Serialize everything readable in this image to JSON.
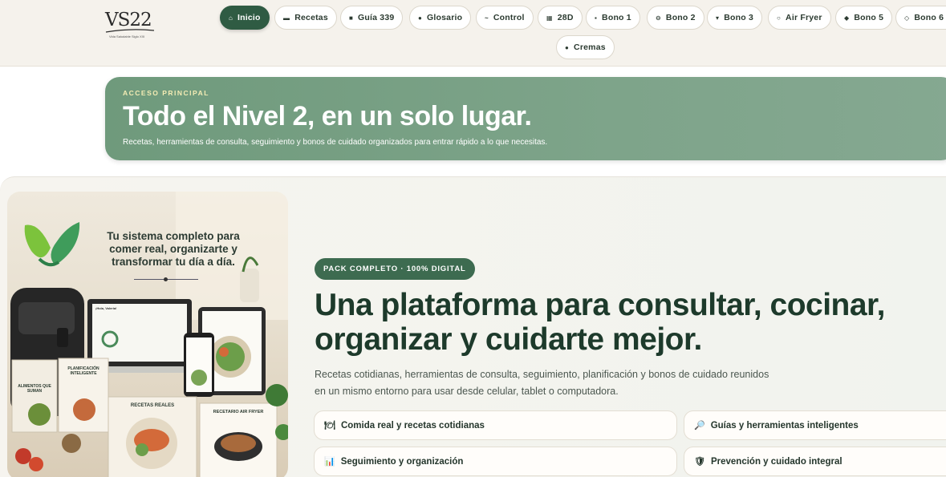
{
  "logo": {
    "text": "VS22",
    "subtitle": "Vida Saludable Siglo XXI"
  },
  "nav": [
    {
      "label": "Inicio",
      "icon": "home-icon",
      "glyph": "⌂"
    },
    {
      "label": "Recetas",
      "icon": "book-icon",
      "glyph": "▬"
    },
    {
      "label": "Guía 339",
      "icon": "guide-icon",
      "glyph": "■"
    },
    {
      "label": "Glosario",
      "icon": "glossary-icon",
      "glyph": "●"
    },
    {
      "label": "Control",
      "icon": "control-icon",
      "glyph": "~"
    },
    {
      "label": "28D",
      "icon": "calendar-icon",
      "glyph": "▦"
    },
    {
      "label": "Bono 1",
      "icon": "bonus-dot-icon",
      "glyph": "▪"
    },
    {
      "label": "Bono 2",
      "icon": "bonus-circle-icon",
      "glyph": "⊖"
    },
    {
      "label": "Bono 3",
      "icon": "bonus-triangle-icon",
      "glyph": "▾"
    },
    {
      "label": "Air Fryer",
      "icon": "air-fryer-icon",
      "glyph": "○"
    },
    {
      "label": "Bono 5",
      "icon": "bonus-diamond-icon",
      "glyph": "◆"
    },
    {
      "label": "Bono 6",
      "icon": "bonus-diamond-outline-icon",
      "glyph": "◇"
    },
    {
      "label": "Cremas",
      "icon": "cream-icon",
      "glyph": "●"
    }
  ],
  "banner": {
    "eyebrow": "ACCESO PRINCIPAL",
    "title": "Todo el Nivel 2, en un solo lugar.",
    "subtitle": "Recetas, herramientas de consulta, seguimiento y bonos de cuidado organizados para entrar rápido a lo que necesitas."
  },
  "product_image": {
    "tagline": "Tu sistema completo para comer real, organizarte y transformar tu día a día.",
    "book1": "ALIMENTOS QUE SUMAN",
    "book2": "PLANIFICACIÓN INTELIGENTE",
    "book3": "RECETAS REALES",
    "book4": "RECETARIO AIR FRYER",
    "greeting": "¡Hola, Valeria!"
  },
  "hero": {
    "badge": "PACK COMPLETO · 100% DIGITAL",
    "headline": "Una plataforma para consultar, cocinar, organizar y cuidarte mejor.",
    "description": "Recetas cotidianas, herramientas de consulta, seguimiento, planificación y bonos de cuidado reunidos en un mismo entorno para usar desde celular, tablet o computadora."
  },
  "features": [
    {
      "label": "Comida real y recetas cotidianas",
      "icon": "utensils-icon",
      "glyph": "🍽",
      "color": "#b07fc4"
    },
    {
      "label": "Guías y herramientas inteligentes",
      "icon": "magnifier-icon",
      "glyph": "🔎",
      "color": "#3a6ea5"
    },
    {
      "label": "Seguimiento y organización",
      "icon": "bar-chart-icon",
      "glyph": "📊",
      "color": "#4a7bd0"
    },
    {
      "label": "Prevención y cuidado integral",
      "icon": "shield-icon",
      "glyph": "🛡",
      "color": "#3d78c9"
    }
  ],
  "colors": {
    "primary": "#2f5b43",
    "banner": "#7ea48a",
    "eyebrow": "#f4ecb4",
    "headline": "#1d3a2b"
  }
}
